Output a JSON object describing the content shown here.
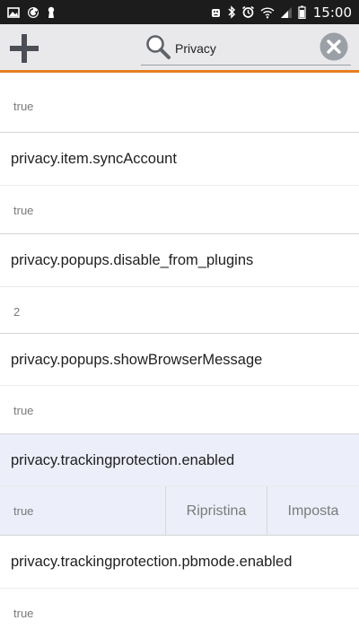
{
  "status_bar": {
    "time": "15:00",
    "left_icons": [
      "image-icon",
      "sync-icon",
      "keyhole-icon"
    ],
    "right_icons": [
      "android-icon",
      "bluetooth-icon",
      "alarm-icon",
      "wifi-icon",
      "signal-icon",
      "battery-icon"
    ]
  },
  "toolbar": {
    "add_icon": "plus-icon",
    "search": {
      "value": "Privacy",
      "icon": "search-icon"
    },
    "clear_icon": "close-circle-icon",
    "accent_color": "#e67e22"
  },
  "prefs": [
    {
      "name": "",
      "value": "true"
    },
    {
      "name": "privacy.item.syncAccount",
      "value": "true"
    },
    {
      "name": "privacy.popups.disable_from_plugins",
      "value": "2"
    },
    {
      "name": "privacy.popups.showBrowserMessage",
      "value": "true"
    },
    {
      "name": "privacy.trackingprotection.enabled",
      "value": "true",
      "selected": true
    },
    {
      "name": "privacy.trackingprotection.pbmode.enabled",
      "value": "true"
    }
  ],
  "actions": {
    "reset_label": "Ripristina",
    "set_label": "Imposta"
  }
}
